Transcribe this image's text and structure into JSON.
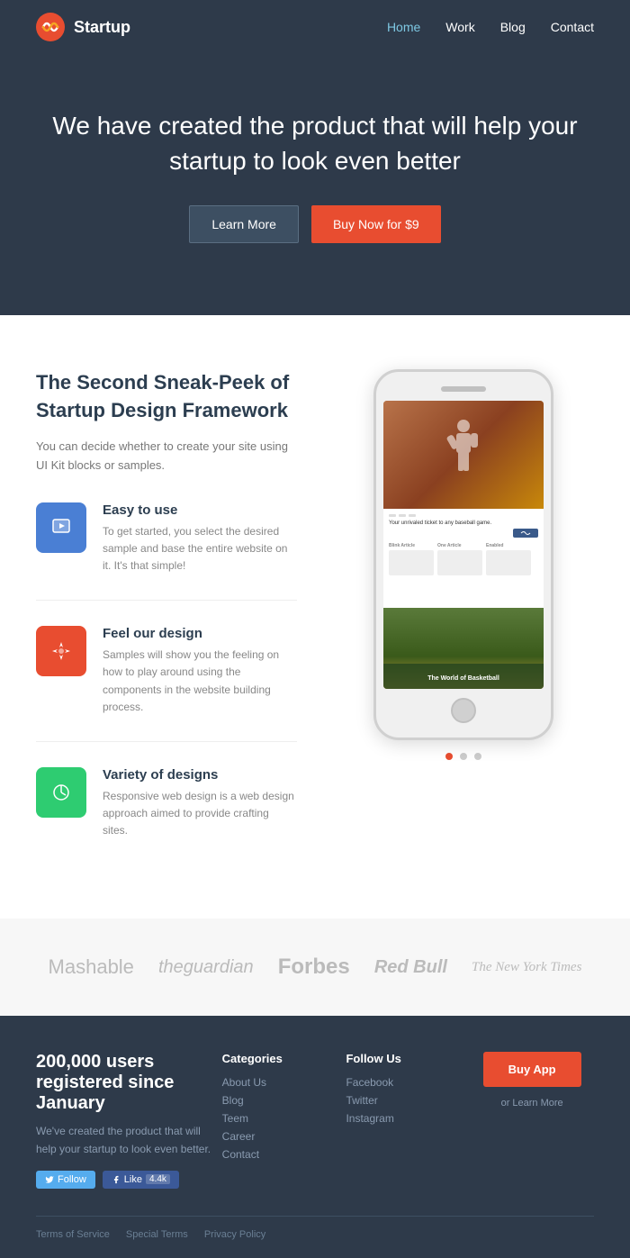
{
  "header": {
    "logo_text": "Startup",
    "nav": {
      "home": "Home",
      "work": "Work",
      "blog": "Blog",
      "contact": "Contact"
    }
  },
  "hero": {
    "headline": "We have created the product that will help your startup to look even better",
    "btn_learn": "Learn More",
    "btn_buy": "Buy Now for $9"
  },
  "features": {
    "title": "The Second Sneak-Peek of Startup Design Framework",
    "subtitle": "You can decide whether to create your site using UI Kit blocks or samples.",
    "items": [
      {
        "title": "Easy to use",
        "description": "To get started, you select the desired sample and base the entire website on it. It's that simple!",
        "icon": "▶"
      },
      {
        "title": "Feel our design",
        "description": "Samples will show you the feeling on how to play around using the components in the website building process.",
        "icon": "✦"
      },
      {
        "title": "Variety of designs",
        "description": "Responsive web design is a web design approach aimed to provide crafting sites.",
        "icon": "◷"
      }
    ]
  },
  "phone": {
    "screen_alt": "App mockup showing sports content",
    "banner_text": "The World of Basketball"
  },
  "carousel": {
    "dots": [
      true,
      false,
      false
    ]
  },
  "logos": {
    "items": [
      "Mashable",
      "theguardian",
      "Forbes",
      "Red Bull",
      "The New York Times"
    ]
  },
  "footer": {
    "stat_text": "200,000 users registered since January",
    "stat_desc": "We've created the product that will help your startup to look even better.",
    "twitter_label": "Follow",
    "fb_label": "Like",
    "fb_count": "4.4k",
    "categories_title": "Categories",
    "categories": [
      "About Us",
      "Blog",
      "Teem",
      "Career",
      "Contact"
    ],
    "follow_title": "Follow Us",
    "follow_links": [
      "Facebook",
      "Twitter",
      "Instagram"
    ],
    "buy_title": "Buy App",
    "or_learn": "or Learn More",
    "bottom_links": [
      "Terms of Service",
      "Special Terms",
      "Privacy Policy"
    ]
  }
}
